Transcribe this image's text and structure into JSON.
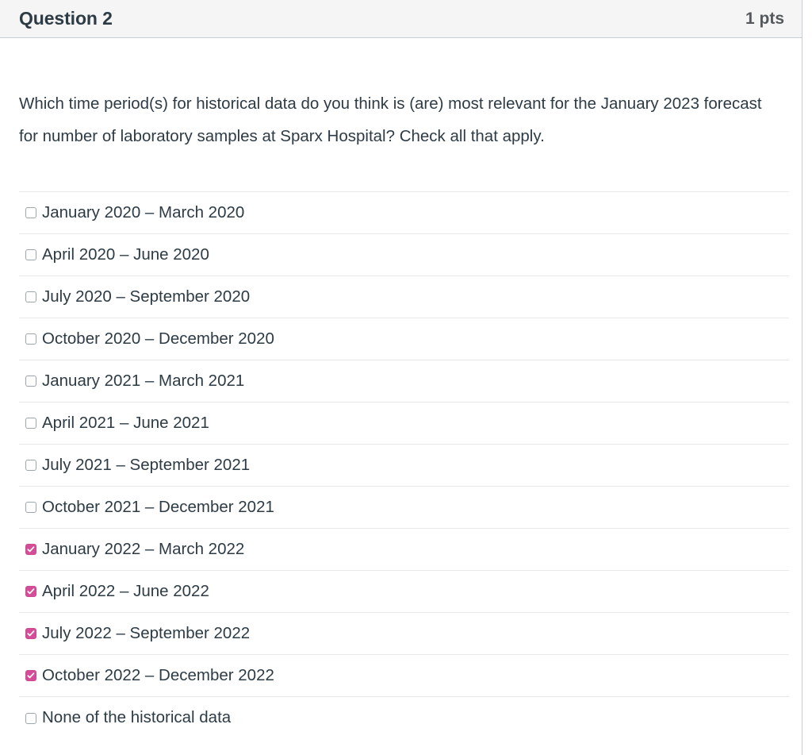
{
  "header": {
    "question_name": "Question 2",
    "points_label": "1 pts"
  },
  "question": {
    "text": "Which time period(s) for historical data do you think is (are) most relevant for the January 2023 forecast for number of laboratory samples at Sparx Hospital? Check all that apply."
  },
  "colors": {
    "header_background": "#f5f5f5",
    "header_border": "#c7cdd1",
    "text": "#2d3b45",
    "points_text": "#55595c",
    "checked_checkbox": "#d34e96",
    "unchecked_checkbox_border": "#9ea6ad",
    "row_divider": "#e8e8e8"
  },
  "answers": [
    {
      "label": "January 2020 – March 2020",
      "checked": false
    },
    {
      "label": "April 2020 – June 2020",
      "checked": false
    },
    {
      "label": "July 2020 – September 2020",
      "checked": false
    },
    {
      "label": "October 2020 – December 2020",
      "checked": false
    },
    {
      "label": "January 2021 – March 2021",
      "checked": false
    },
    {
      "label": "April 2021 – June 2021",
      "checked": false
    },
    {
      "label": "July 2021 – September 2021",
      "checked": false
    },
    {
      "label": "October 2021 – December 2021",
      "checked": false
    },
    {
      "label": "January 2022 – March 2022",
      "checked": true
    },
    {
      "label": "April 2022 – June 2022",
      "checked": true
    },
    {
      "label": "July 2022 – September 2022",
      "checked": true
    },
    {
      "label": "October 2022 – December 2022",
      "checked": true
    },
    {
      "label": "None of the historical data",
      "checked": false
    }
  ]
}
